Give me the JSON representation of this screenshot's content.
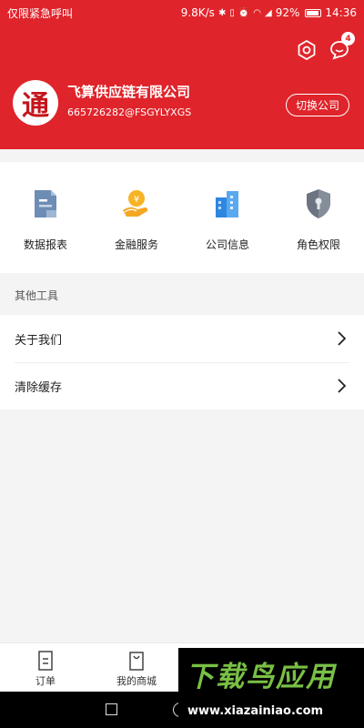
{
  "status_bar": {
    "carrier": "仅限紧急呼叫",
    "speed": "9.8K/s",
    "battery": "92%",
    "time": "14:36"
  },
  "header": {
    "notification_badge": "4",
    "company_logo_char": "通",
    "company_name": "飞算供应链有限公司",
    "company_code": "665726282@FSGYLYXGS",
    "switch_label": "切换公司"
  },
  "menu": [
    {
      "label": "数据报表",
      "icon": "report-icon"
    },
    {
      "label": "金融服务",
      "icon": "finance-icon"
    },
    {
      "label": "公司信息",
      "icon": "building-icon"
    },
    {
      "label": "角色权限",
      "icon": "shield-icon"
    }
  ],
  "section_title": "其他工具",
  "list": [
    {
      "label": "关于我们"
    },
    {
      "label": "清除缓存"
    }
  ],
  "tabs": [
    {
      "label": "订单",
      "icon": "order-icon"
    },
    {
      "label": "我的商城",
      "icon": "shop-icon"
    }
  ],
  "watermark": {
    "title": "下载鸟应用",
    "url": "www.xiazainiao.com"
  },
  "colors": {
    "brand": "#e0242b",
    "watermark_green": "#79c045"
  }
}
